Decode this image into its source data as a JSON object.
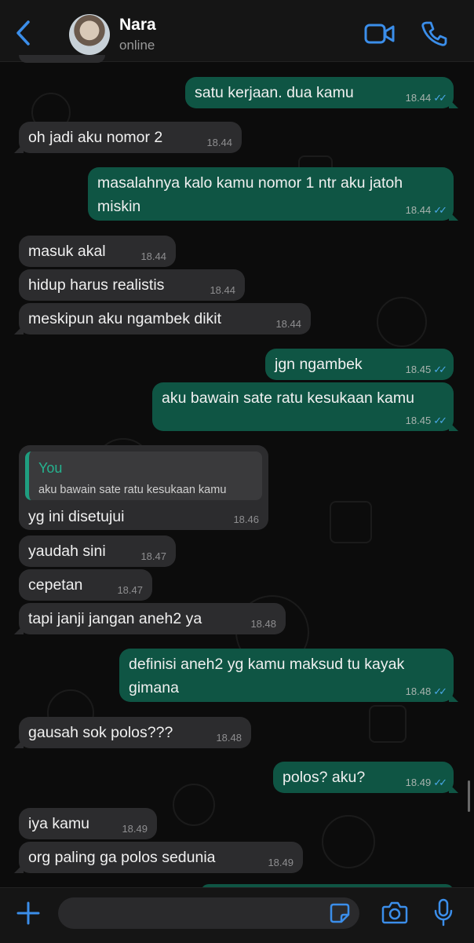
{
  "header": {
    "contact_name": "Nara",
    "contact_status": "online",
    "icons": [
      "back-chevron-icon",
      "video-call-icon",
      "phone-call-icon"
    ]
  },
  "colors": {
    "outgoing_bubble": "#0f5544",
    "incoming_bubble": "#2c2c2e",
    "accent_blue": "#3b8eea",
    "read_ticks": "#4aa8e8",
    "quote_author": "#25b38f"
  },
  "messages": [
    {
      "dir": "out",
      "lines": [
        "satu kerjaan. dua kamu"
      ],
      "time": "18.44",
      "read": true
    },
    {
      "dir": "in",
      "lines": [
        "oh jadi aku nomor 2"
      ],
      "time": "18.44"
    },
    {
      "dir": "out",
      "lines": [
        "masalahnya kalo kamu nomor 1 ntr aku jatoh",
        "miskin"
      ],
      "time": "18.44",
      "read": true
    },
    {
      "dir": "in",
      "lines": [
        "masuk akal"
      ],
      "time": "18.44"
    },
    {
      "dir": "in",
      "lines": [
        "hidup harus realistis"
      ],
      "time": "18.44"
    },
    {
      "dir": "in",
      "lines": [
        "meskipun aku ngambek dikit"
      ],
      "time": "18.44"
    },
    {
      "dir": "out",
      "lines": [
        "jgn ngambek"
      ],
      "time": "18.45",
      "read": true
    },
    {
      "dir": "out",
      "lines": [
        "aku bawain sate ratu kesukaan kamu"
      ],
      "time": "18.45",
      "read": true
    },
    {
      "dir": "in",
      "quote": {
        "author": "You",
        "text": "aku bawain sate ratu kesukaan kamu"
      },
      "lines": [
        "yg ini disetujui"
      ],
      "time": "18.46"
    },
    {
      "dir": "in",
      "lines": [
        "yaudah sini"
      ],
      "time": "18.47"
    },
    {
      "dir": "in",
      "lines": [
        "cepetan"
      ],
      "time": "18.47"
    },
    {
      "dir": "in",
      "lines": [
        "tapi janji jangan aneh2 ya"
      ],
      "time": "18.48"
    },
    {
      "dir": "out",
      "lines": [
        "definisi aneh2 yg kamu maksud tu kayak",
        "gimana"
      ],
      "time": "18.48",
      "read": true
    },
    {
      "dir": "in",
      "lines": [
        "gausah sok polos???"
      ],
      "time": "18.48"
    },
    {
      "dir": "out",
      "lines": [
        "polos? aku?"
      ],
      "time": "18.49",
      "read": true
    },
    {
      "dir": "in",
      "lines": [
        "iya kamu"
      ],
      "time": "18.49"
    },
    {
      "dir": "in",
      "lines": [
        "org paling ga polos sedunia"
      ],
      "time": "18.49"
    }
  ],
  "footer": {
    "icons": [
      "plus-icon",
      "sticker-icon",
      "camera-icon",
      "microphone-icon"
    ],
    "input_value": ""
  }
}
